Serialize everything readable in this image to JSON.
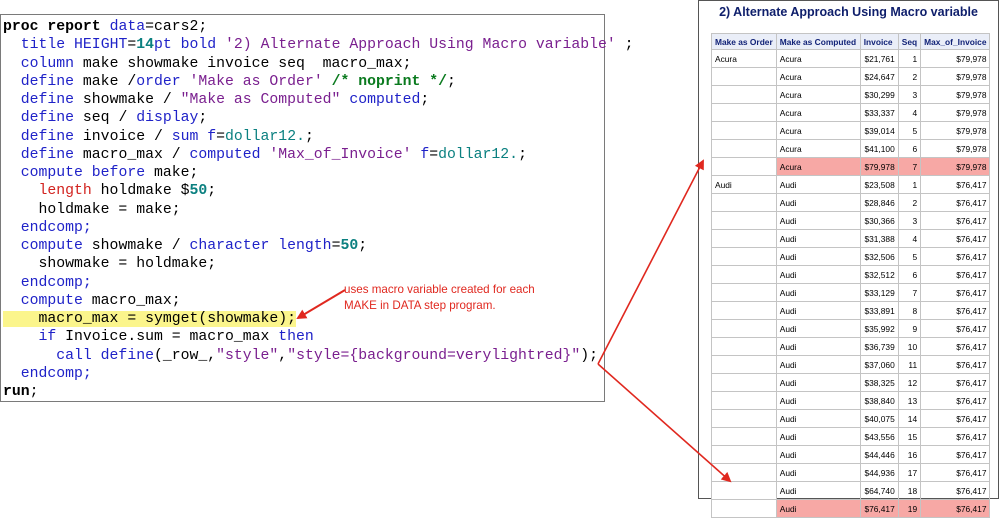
{
  "code": {
    "lines": [
      [
        {
          "t": "proc report",
          "c": "b"
        },
        {
          "t": " data",
          "c": "k"
        },
        {
          "t": "=cars2;",
          "c": ""
        }
      ],
      [
        {
          "t": "  title",
          "c": "k"
        },
        {
          "t": " HEIGHT",
          "c": "k"
        },
        {
          "t": "=",
          "c": ""
        },
        {
          "t": "14",
          "c": "n"
        },
        {
          "t": "pt",
          "c": "k"
        },
        {
          "t": " bold",
          "c": "k"
        },
        {
          "t": " '2) Alternate Approach Using Macro variable'",
          "c": "s"
        },
        {
          "t": " ;",
          "c": ""
        }
      ],
      [
        {
          "t": "  column",
          "c": "k"
        },
        {
          "t": " make showmake invoice seq  macro_max;",
          "c": ""
        }
      ],
      [
        {
          "t": "  define",
          "c": "k"
        },
        {
          "t": " make /",
          "c": ""
        },
        {
          "t": "order",
          "c": "k"
        },
        {
          "t": " 'Make as Order'",
          "c": "s"
        },
        {
          "t": " /* noprint */",
          "c": "c"
        },
        {
          "t": ";",
          "c": ""
        }
      ],
      [
        {
          "t": "  define",
          "c": "k"
        },
        {
          "t": " showmake / ",
          "c": ""
        },
        {
          "t": "\"Make as Computed\"",
          "c": "s"
        },
        {
          "t": " computed",
          "c": "k"
        },
        {
          "t": ";",
          "c": ""
        }
      ],
      [
        {
          "t": "  define",
          "c": "k"
        },
        {
          "t": " seq / ",
          "c": ""
        },
        {
          "t": "display",
          "c": "k"
        },
        {
          "t": ";",
          "c": ""
        }
      ],
      [
        {
          "t": "  define",
          "c": "k"
        },
        {
          "t": " invoice / ",
          "c": ""
        },
        {
          "t": "sum",
          "c": "k"
        },
        {
          "t": " f",
          "c": "k"
        },
        {
          "t": "=",
          "c": ""
        },
        {
          "t": "dollar12.",
          "c": "f"
        },
        {
          "t": ";",
          "c": ""
        }
      ],
      [
        {
          "t": "  define",
          "c": "k"
        },
        {
          "t": " macro_max / ",
          "c": ""
        },
        {
          "t": "computed",
          "c": "k"
        },
        {
          "t": " 'Max_of_Invoice'",
          "c": "s"
        },
        {
          "t": " f",
          "c": "k"
        },
        {
          "t": "=",
          "c": ""
        },
        {
          "t": "dollar12.",
          "c": "f"
        },
        {
          "t": ";",
          "c": ""
        }
      ],
      [
        {
          "t": "  compute",
          "c": "k"
        },
        {
          "t": " before",
          "c": "k"
        },
        {
          "t": " make;",
          "c": ""
        }
      ],
      [
        {
          "t": "    length",
          "c": "r"
        },
        {
          "t": " holdmake $",
          "c": ""
        },
        {
          "t": "50",
          "c": "n"
        },
        {
          "t": ";",
          "c": ""
        }
      ],
      [
        {
          "t": "    holdmake = make;",
          "c": ""
        }
      ],
      [
        {
          "t": "  endcomp;",
          "c": "k"
        }
      ],
      [
        {
          "t": "  compute",
          "c": "k"
        },
        {
          "t": " showmake / ",
          "c": ""
        },
        {
          "t": "character",
          "c": "k"
        },
        {
          "t": " length",
          "c": "k"
        },
        {
          "t": "=",
          "c": ""
        },
        {
          "t": "50",
          "c": "n"
        },
        {
          "t": ";",
          "c": ""
        }
      ],
      [
        {
          "t": "    showmake = holdmake;",
          "c": ""
        }
      ],
      [
        {
          "t": "  endcomp;",
          "c": "k"
        }
      ],
      [
        {
          "t": "  compute",
          "c": "k"
        },
        {
          "t": " macro_max;",
          "c": ""
        }
      ],
      [
        {
          "t": "    macro_max = symget(showmake);",
          "c": "hl"
        }
      ],
      [
        {
          "t": "    if",
          "c": "k"
        },
        {
          "t": " Invoice.sum = macro_max ",
          "c": ""
        },
        {
          "t": "then",
          "c": "k"
        }
      ],
      [
        {
          "t": "      call define",
          "c": "k"
        },
        {
          "t": "(_row_,",
          "c": ""
        },
        {
          "t": "\"style\"",
          "c": "s"
        },
        {
          "t": ",",
          "c": ""
        },
        {
          "t": "\"style={background=verylightred}\"",
          "c": "s"
        },
        {
          "t": ");",
          "c": ""
        }
      ],
      [
        {
          "t": "  endcomp;",
          "c": "k"
        }
      ],
      [
        {
          "t": "run",
          "c": "b"
        },
        {
          "t": ";",
          "c": ""
        }
      ]
    ]
  },
  "annotation": {
    "line1": "uses macro variable created for each",
    "line2": "MAKE in DATA step program."
  },
  "report": {
    "title": "2) Alternate Approach Using Macro variable",
    "columns": [
      "Make as Order",
      "Make as Computed",
      "Invoice",
      "Seq",
      "Max_of_Invoice"
    ],
    "rows": [
      {
        "order": "Acura",
        "computed": "Acura",
        "invoice": "$21,761",
        "seq": "1",
        "max": "$79,978",
        "hi": false
      },
      {
        "order": "",
        "computed": "Acura",
        "invoice": "$24,647",
        "seq": "2",
        "max": "$79,978",
        "hi": false
      },
      {
        "order": "",
        "computed": "Acura",
        "invoice": "$30,299",
        "seq": "3",
        "max": "$79,978",
        "hi": false
      },
      {
        "order": "",
        "computed": "Acura",
        "invoice": "$33,337",
        "seq": "4",
        "max": "$79,978",
        "hi": false
      },
      {
        "order": "",
        "computed": "Acura",
        "invoice": "$39,014",
        "seq": "5",
        "max": "$79,978",
        "hi": false
      },
      {
        "order": "",
        "computed": "Acura",
        "invoice": "$41,100",
        "seq": "6",
        "max": "$79,978",
        "hi": false
      },
      {
        "order": "",
        "computed": "Acura",
        "invoice": "$79,978",
        "seq": "7",
        "max": "$79,978",
        "hi": true
      },
      {
        "order": "Audi",
        "computed": "Audi",
        "invoice": "$23,508",
        "seq": "1",
        "max": "$76,417",
        "hi": false
      },
      {
        "order": "",
        "computed": "Audi",
        "invoice": "$28,846",
        "seq": "2",
        "max": "$76,417",
        "hi": false
      },
      {
        "order": "",
        "computed": "Audi",
        "invoice": "$30,366",
        "seq": "3",
        "max": "$76,417",
        "hi": false
      },
      {
        "order": "",
        "computed": "Audi",
        "invoice": "$31,388",
        "seq": "4",
        "max": "$76,417",
        "hi": false
      },
      {
        "order": "",
        "computed": "Audi",
        "invoice": "$32,506",
        "seq": "5",
        "max": "$76,417",
        "hi": false
      },
      {
        "order": "",
        "computed": "Audi",
        "invoice": "$32,512",
        "seq": "6",
        "max": "$76,417",
        "hi": false
      },
      {
        "order": "",
        "computed": "Audi",
        "invoice": "$33,129",
        "seq": "7",
        "max": "$76,417",
        "hi": false
      },
      {
        "order": "",
        "computed": "Audi",
        "invoice": "$33,891",
        "seq": "8",
        "max": "$76,417",
        "hi": false
      },
      {
        "order": "",
        "computed": "Audi",
        "invoice": "$35,992",
        "seq": "9",
        "max": "$76,417",
        "hi": false
      },
      {
        "order": "",
        "computed": "Audi",
        "invoice": "$36,739",
        "seq": "10",
        "max": "$76,417",
        "hi": false
      },
      {
        "order": "",
        "computed": "Audi",
        "invoice": "$37,060",
        "seq": "11",
        "max": "$76,417",
        "hi": false
      },
      {
        "order": "",
        "computed": "Audi",
        "invoice": "$38,325",
        "seq": "12",
        "max": "$76,417",
        "hi": false
      },
      {
        "order": "",
        "computed": "Audi",
        "invoice": "$38,840",
        "seq": "13",
        "max": "$76,417",
        "hi": false
      },
      {
        "order": "",
        "computed": "Audi",
        "invoice": "$40,075",
        "seq": "14",
        "max": "$76,417",
        "hi": false
      },
      {
        "order": "",
        "computed": "Audi",
        "invoice": "$43,556",
        "seq": "15",
        "max": "$76,417",
        "hi": false
      },
      {
        "order": "",
        "computed": "Audi",
        "invoice": "$44,446",
        "seq": "16",
        "max": "$76,417",
        "hi": false
      },
      {
        "order": "",
        "computed": "Audi",
        "invoice": "$44,936",
        "seq": "17",
        "max": "$76,417",
        "hi": false
      },
      {
        "order": "",
        "computed": "Audi",
        "invoice": "$64,740",
        "seq": "18",
        "max": "$76,417",
        "hi": false
      },
      {
        "order": "",
        "computed": "Audi",
        "invoice": "$76,417",
        "seq": "19",
        "max": "$76,417",
        "hi": true
      }
    ]
  },
  "colors": {
    "keyword": "#1f22c8",
    "string": "#7a1f8f",
    "number": "#0b8080",
    "comment": "#0a7a1e",
    "highlight_code": "#fbf58c",
    "highlight_row": "#f7a8a5",
    "annotation": "#e0281f",
    "title": "#0e1e6b"
  }
}
